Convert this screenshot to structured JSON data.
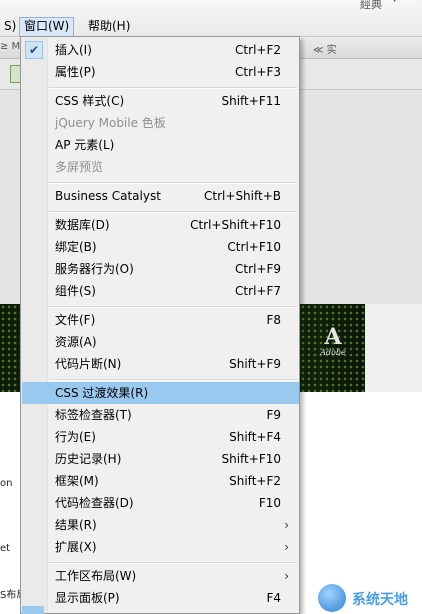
{
  "menubar": {
    "items": [
      {
        "label": "S)"
      },
      {
        "label": "窗口(W)"
      },
      {
        "label": "帮助(H)"
      }
    ],
    "workspace_label": "經典"
  },
  "toolbar2": {
    "left_text": "≥ Ma",
    "right_text": "≪ 实"
  },
  "page_fragments": [
    "on",
    "et",
    "S布局"
  ],
  "adobe_logo": {
    "mark": "A",
    "word": "Adobe"
  },
  "window_menu": {
    "items": [
      {
        "label": "插入(I)",
        "shortcut": "Ctrl+F2",
        "checked": true
      },
      {
        "label": "属性(P)",
        "shortcut": "Ctrl+F3"
      },
      {
        "label": "CSS 样式(C)",
        "shortcut": "Shift+F11"
      },
      {
        "label": "jQuery Mobile 色板",
        "shortcut": "",
        "disabled": true
      },
      {
        "label": "AP 元素(L)",
        "shortcut": ""
      },
      {
        "label": "多屏预览",
        "shortcut": "",
        "disabled": true
      },
      {
        "label": "Business Catalyst",
        "shortcut": "Ctrl+Shift+B"
      },
      {
        "label": "数据库(D)",
        "shortcut": "Ctrl+Shift+F10"
      },
      {
        "label": "绑定(B)",
        "shortcut": "Ctrl+F10"
      },
      {
        "label": "服务器行为(O)",
        "shortcut": "Ctrl+F9"
      },
      {
        "label": "组件(S)",
        "shortcut": "Ctrl+F7"
      },
      {
        "label": "文件(F)",
        "shortcut": "F8"
      },
      {
        "label": "资源(A)",
        "shortcut": ""
      },
      {
        "label": "代码片断(N)",
        "shortcut": "Shift+F9"
      },
      {
        "label": "CSS 过渡效果(R)",
        "shortcut": "",
        "highlighted": true
      },
      {
        "label": "标签检查器(T)",
        "shortcut": "F9"
      },
      {
        "label": "行为(E)",
        "shortcut": "Shift+F4"
      },
      {
        "label": "历史记录(H)",
        "shortcut": "Shift+F10"
      },
      {
        "label": "框架(M)",
        "shortcut": "Shift+F2"
      },
      {
        "label": "代码检查器(D)",
        "shortcut": "F10"
      },
      {
        "label": "结果(R)",
        "shortcut": "",
        "submenu": true
      },
      {
        "label": "扩展(X)",
        "shortcut": "",
        "submenu": true
      },
      {
        "label": "工作区布局(W)",
        "shortcut": "",
        "submenu": true
      },
      {
        "label": "显示面板(P)",
        "shortcut": "F4"
      }
    ]
  },
  "watermark": {
    "text": "系统天地"
  },
  "icons": {
    "check": "checkmark-icon",
    "submenu": "chevron-right-icon"
  },
  "colors": {
    "highlight": "#99c9ef",
    "menu_bg": "#f0f0f0"
  }
}
